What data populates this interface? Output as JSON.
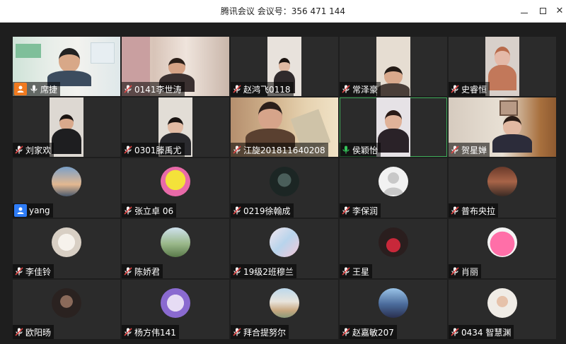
{
  "window": {
    "title": "腾讯会议 会议号：356 471 144",
    "controls": {
      "minimize": "minimize",
      "maximize": "maximize",
      "close": "close"
    }
  },
  "colors": {
    "stage_bg": "#1e1e1e",
    "tile_bg": "#2b2b2b",
    "active_speaker_border": "#3fae5a",
    "host_badge": "#f07a1f",
    "participant_badge": "#2e7cf6",
    "mic_muted": "#e04646",
    "mic_on": "#ffffff",
    "mic_speaking": "#35c45a"
  },
  "participants": [
    {
      "name": "席捷",
      "mic": "on",
      "badge": "host",
      "media": "video"
    },
    {
      "name": "0141李世涛",
      "mic": "muted",
      "media": "video"
    },
    {
      "name": "赵鸿飞0118",
      "mic": "muted",
      "media": "video"
    },
    {
      "name": "常泽豪",
      "mic": "muted",
      "media": "video"
    },
    {
      "name": "史睿恒",
      "mic": "muted",
      "media": "video"
    },
    {
      "name": "刘家欢",
      "mic": "muted",
      "media": "video"
    },
    {
      "name": "0301滕禹尤",
      "mic": "muted",
      "media": "video"
    },
    {
      "name": "江旋201811640208",
      "mic": "muted",
      "media": "video"
    },
    {
      "name": "侯颖怡",
      "mic": "speaking",
      "media": "video",
      "active": true
    },
    {
      "name": "贺星婵",
      "mic": "muted",
      "media": "video"
    },
    {
      "name": "yang",
      "mic": "none",
      "badge": "participant",
      "media": "avatar",
      "avatar_icon": "sunset-sky-avatar"
    },
    {
      "name": "张立卓 06",
      "mic": "muted",
      "media": "avatar",
      "avatar_icon": "spongebob-avatar"
    },
    {
      "name": "0219徐翰成",
      "mic": "muted",
      "media": "avatar",
      "avatar_icon": "dark-character-avatar"
    },
    {
      "name": "李保润",
      "mic": "muted",
      "media": "avatar",
      "avatar_icon": "default-user-avatar"
    },
    {
      "name": "普布央拉",
      "mic": "muted",
      "media": "avatar",
      "avatar_icon": "group-photo-avatar"
    },
    {
      "name": "李佳铃",
      "mic": "muted",
      "media": "avatar",
      "avatar_icon": "white-dog-avatar"
    },
    {
      "name": "陈娇君",
      "mic": "muted",
      "media": "avatar",
      "avatar_icon": "landscape-avatar"
    },
    {
      "name": "19级2班穆兰",
      "mic": "muted",
      "media": "avatar",
      "avatar_icon": "anime-girl-avatar"
    },
    {
      "name": "王星",
      "mic": "muted",
      "media": "avatar",
      "avatar_icon": "red-figure-avatar"
    },
    {
      "name": "肖丽",
      "mic": "muted",
      "media": "avatar",
      "avatar_icon": "kirby-avatar"
    },
    {
      "name": "欧阳旸",
      "mic": "muted",
      "media": "avatar",
      "avatar_icon": "dark-portrait-avatar"
    },
    {
      "name": "杨方伟141",
      "mic": "muted",
      "media": "avatar",
      "avatar_icon": "purple-cartoon-avatar"
    },
    {
      "name": "拜合提努尔",
      "mic": "muted",
      "media": "avatar",
      "avatar_icon": "building-avatar"
    },
    {
      "name": "赵嘉敏207",
      "mic": "muted",
      "media": "avatar",
      "avatar_icon": "anime-character-avatar"
    },
    {
      "name": "0434 智慧渊",
      "mic": "muted",
      "media": "avatar",
      "avatar_icon": "girl-photo-avatar"
    }
  ]
}
